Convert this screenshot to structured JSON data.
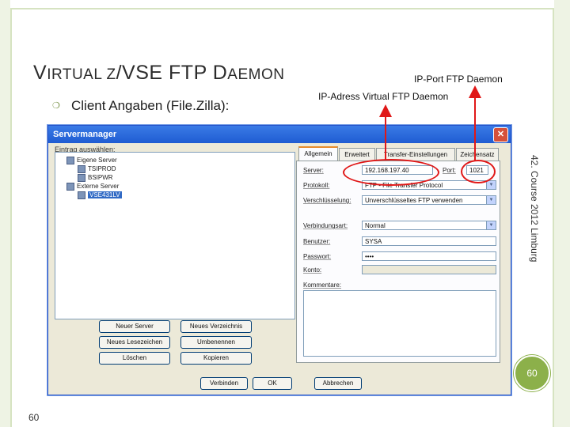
{
  "slide": {
    "title_cap1": "V",
    "title_rest1": "IRTUAL ",
    "title_cap2": "Z",
    "title_mid": "/VSE FTP D",
    "title_rest2": "AEMON",
    "bullet": "Client Angaben (File.Zilla):",
    "annotation_port": "IP-Port FTP Daemon",
    "annotation_ip": "IP-Adress Virtual FTP Daemon",
    "vertical_note": "42. Course 2012 Limburg",
    "badge": "60",
    "page_number": "60",
    "highlight_color": "#e01818",
    "accent_color": "#8cb04a"
  },
  "window": {
    "title": "Servermanager",
    "close_icon": "close-icon",
    "entry_label": "Eintrag auswählen:",
    "tree": [
      {
        "label": "Eigene Server",
        "selected": false
      },
      {
        "label": "TSIPROD",
        "selected": false
      },
      {
        "label": "BSIPWR",
        "selected": false
      },
      {
        "label": "Externe Server",
        "selected": false
      },
      {
        "label": "VSE431LV",
        "selected": true
      }
    ],
    "buttons": {
      "new_server": "Neuer Server",
      "new_folder": "Neues Verzeichnis",
      "new_bookmark": "Neues Lesezeichen",
      "rename": "Umbenennen",
      "delete": "Löschen",
      "copy": "Kopieren",
      "connect": "Verbinden",
      "ok": "OK",
      "cancel": "Abbrechen"
    },
    "tabs": [
      "Allgemein",
      "Erweitert",
      "Transfer-Einstellungen",
      "Zeichensatz"
    ],
    "form": {
      "server_label": "Server:",
      "server_value": "192.168.197.40",
      "port_label": "Port:",
      "port_value": "1021",
      "protocol_label": "Protokoll:",
      "protocol_value": "FTP - File Transfer Protocol",
      "encryption_label": "Verschlüsselung:",
      "encryption_value": "Unverschlüsseltes FTP verwenden",
      "logon_label": "Verbindungsart:",
      "logon_value": "Normal",
      "user_label": "Benutzer:",
      "user_value": "SYSA",
      "password_label": "Passwort:",
      "password_value": "••••",
      "account_label": "Konto:",
      "comments_label": "Kommentare:"
    }
  }
}
